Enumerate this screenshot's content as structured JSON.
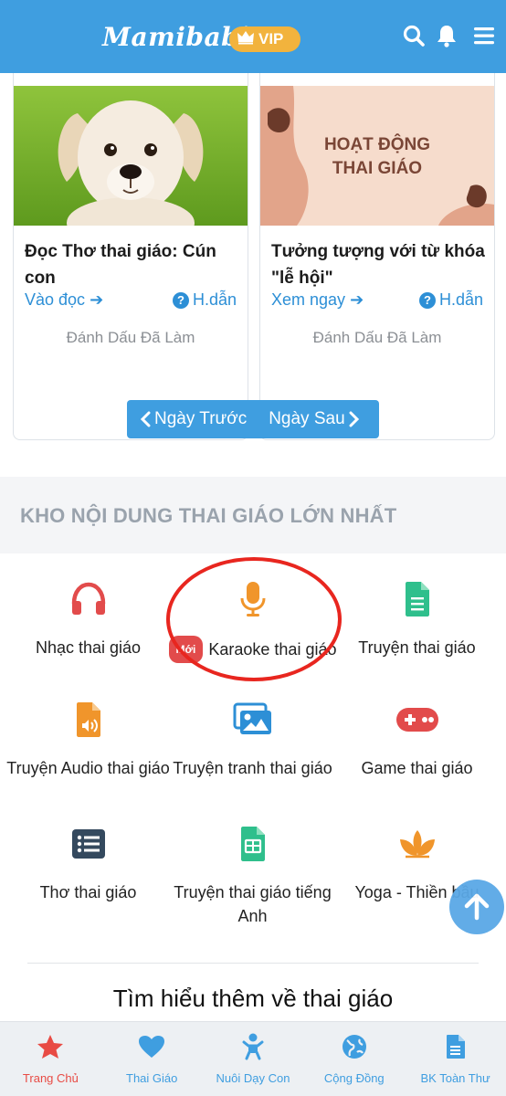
{
  "header": {
    "logo": "Mamibabi",
    "vip_label": "VIP"
  },
  "cards": [
    {
      "title": "Đọc Thơ thai giáo: Cún con",
      "link_label": "Vào đọc",
      "help_label": "H.dẫn",
      "mark_label": "Đánh Dấu Đã Làm"
    },
    {
      "title": "Tưởng tượng với từ khóa \"lễ hội\"",
      "link_label": "Xem ngay",
      "help_label": "H.dẫn",
      "mark_label": "Đánh Dấu Đã Làm",
      "image_text_line1": "HOẠT ĐỘNG",
      "image_text_line2": "THAI GIÁO"
    }
  ],
  "pager": {
    "prev_label": "Ngày Trước",
    "next_label": "Ngày Sau"
  },
  "section": {
    "title": "KHO NỘI DUNG THAI GIÁO LỚN NHẤT"
  },
  "categories": [
    {
      "label": "Nhạc thai giáo",
      "icon": "headphones-icon",
      "color": "#e24b4b"
    },
    {
      "label": "Karaoke thai giáo",
      "badge": "Mới",
      "icon": "microphone-icon",
      "color": "#f0952b"
    },
    {
      "label": "Truyện thai giáo",
      "icon": "document-icon",
      "color": "#2fbf8c"
    },
    {
      "label": "Truyện Audio thai giáo",
      "icon": "audio-file-icon",
      "color": "#f0952b"
    },
    {
      "label": "Truyện tranh thai giáo",
      "icon": "images-icon",
      "color": "#2d8fd6"
    },
    {
      "label": "Game thai giáo",
      "icon": "gamepad-icon",
      "color": "#e24b4b"
    },
    {
      "label": "Thơ thai giáo",
      "icon": "list-icon",
      "color": "#34495e"
    },
    {
      "label": "Truyện thai giáo tiếng Anh",
      "icon": "document-icon",
      "color": "#2fbf8c"
    },
    {
      "label": "Yoga - Thiền bầu",
      "icon": "lotus-icon",
      "color": "#f0952b"
    }
  ],
  "more_title": "Tìm hiểu thêm về thai giáo",
  "bottom_nav": [
    {
      "label": "Trang Chủ",
      "icon": "star-icon",
      "active": true
    },
    {
      "label": "Thai Giáo",
      "icon": "heart-icon"
    },
    {
      "label": "Nuôi Dạy Con",
      "icon": "baby-icon"
    },
    {
      "label": "Cộng Đồng",
      "icon": "globe-icon"
    },
    {
      "label": "BK Toàn Thư",
      "icon": "book-file-icon"
    }
  ],
  "colors": {
    "primary": "#3f9ee0",
    "vip": "#f2b33d",
    "active_nav": "#e84b44",
    "highlight": "#e8261f"
  }
}
